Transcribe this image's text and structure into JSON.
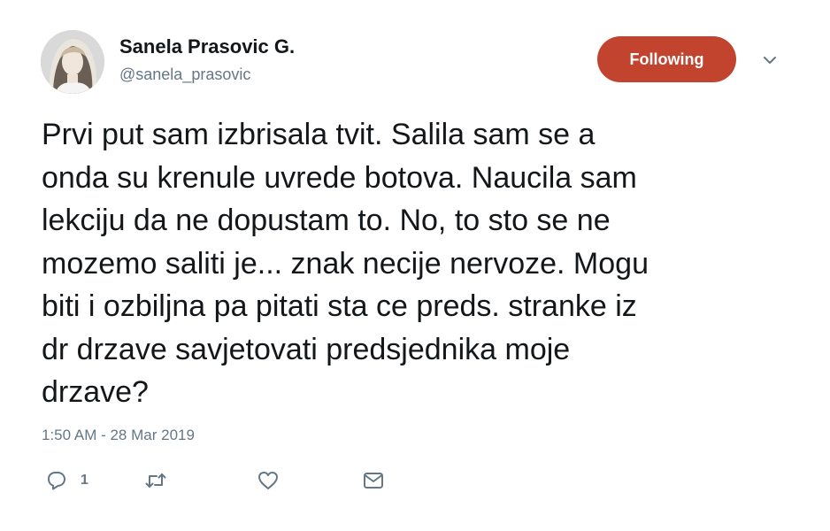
{
  "author": {
    "display_name": "Sanela Prasovic G.",
    "handle": "@sanela_prasovic"
  },
  "follow_button": {
    "label": "Following"
  },
  "tweet": {
    "lines": [
      "Prvi put sam izbrisala tvit. Salila sam se a",
      "onda su krenule uvrede botova. Naucila sam",
      "lekciju da ne dopustam to. No, to sto se ne",
      "mozemo saliti je... znak necije nervoze. Mogu",
      "biti i ozbiljna pa pitati sta ce preds. stranke iz",
      "dr drzave savjetovati predsjednika moje",
      "drzave?"
    ],
    "timestamp": "1:50 AM - 28 Mar 2019"
  },
  "actions": {
    "reply_count": "1",
    "icons": [
      "reply-icon",
      "retweet-icon",
      "like-icon",
      "direct-message-icon"
    ]
  },
  "colors": {
    "follow_button_bg": "#c2442f",
    "secondary_text": "#657786",
    "primary_text": "#14171a"
  }
}
